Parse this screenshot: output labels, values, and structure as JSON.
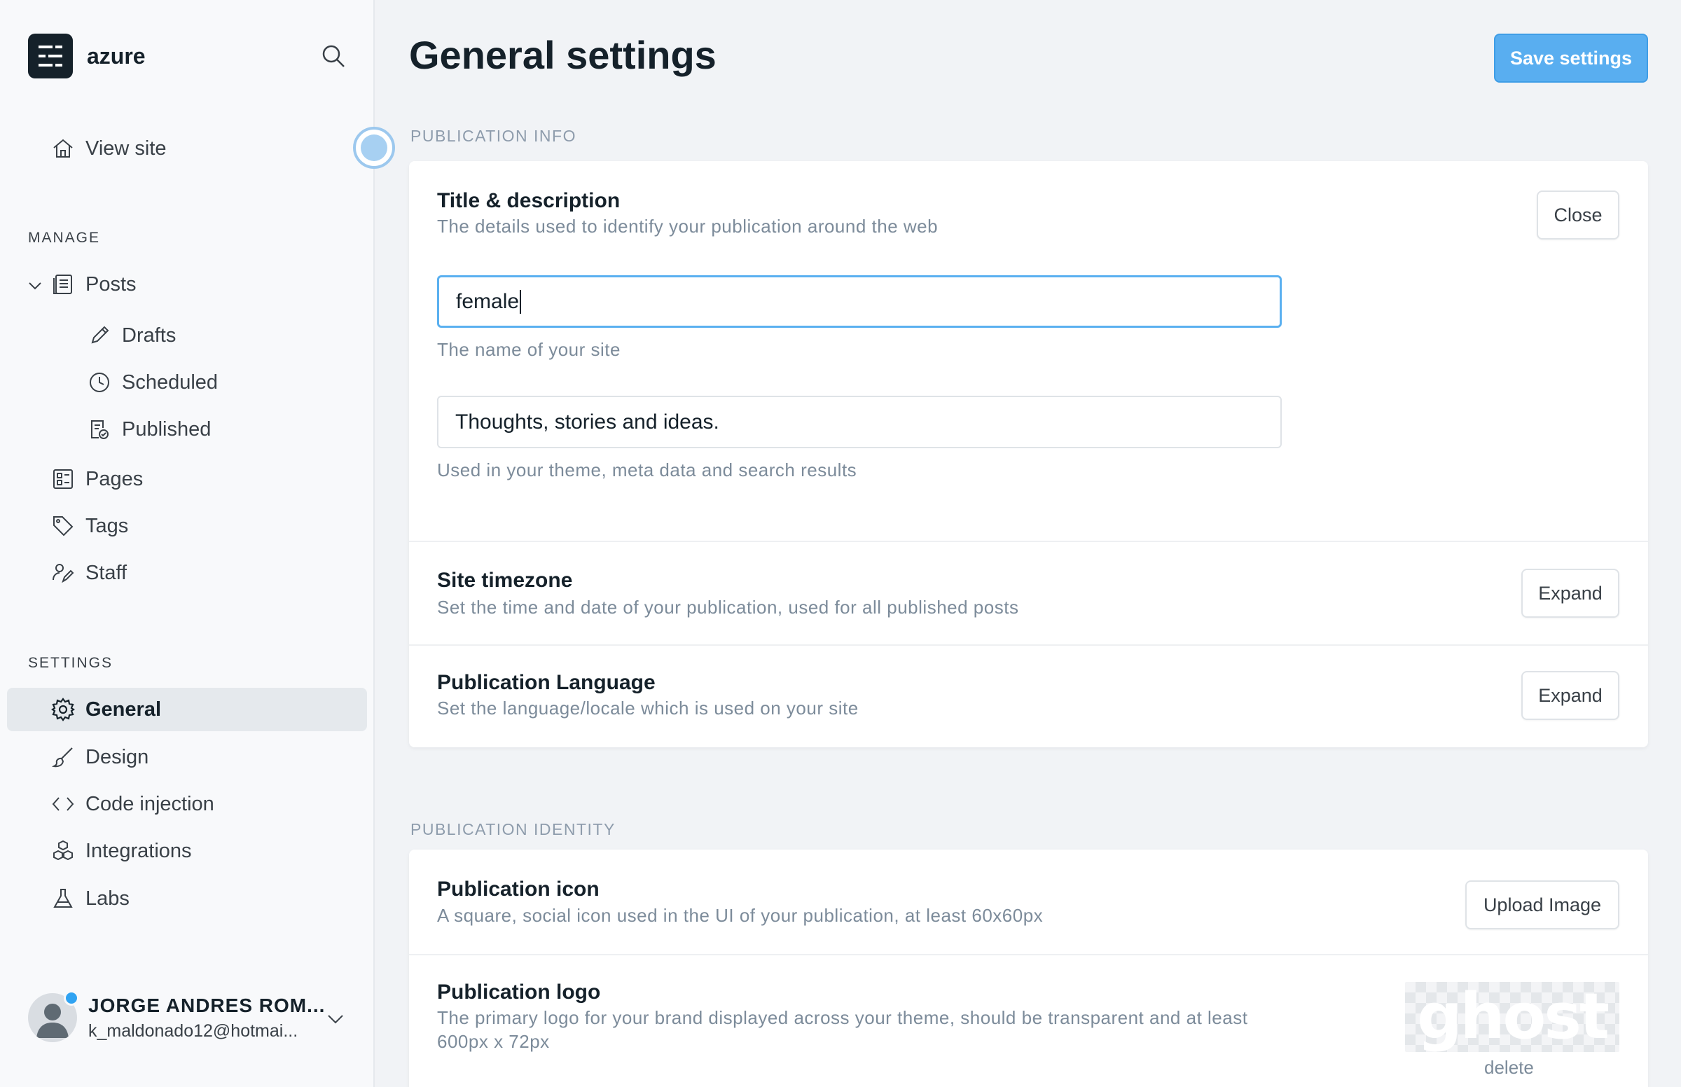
{
  "sidebar": {
    "brand": "azure",
    "view_site": "View site",
    "manage_label": "MANAGE",
    "manage_items": {
      "posts": "Posts",
      "drafts": "Drafts",
      "scheduled": "Scheduled",
      "published": "Published",
      "pages": "Pages",
      "tags": "Tags",
      "staff": "Staff"
    },
    "settings_label": "SETTINGS",
    "settings_items": {
      "general": "General",
      "design": "Design",
      "code_injection": "Code injection",
      "integrations": "Integrations",
      "labs": "Labs"
    },
    "user": {
      "name": "JORGE ANDRES ROM...",
      "email": "k_maldonado12@hotmai..."
    }
  },
  "header": {
    "title": "General settings",
    "save_label": "Save settings"
  },
  "publication_info": {
    "label": "PUBLICATION INFO",
    "title_desc": {
      "title": "Title & description",
      "desc": "The details used to identify your publication around the web",
      "close_label": "Close",
      "site_title_value": "female",
      "site_title_hint": "The name of your site",
      "site_desc_value": "Thoughts, stories and ideas.",
      "site_desc_hint": "Used in your theme, meta data and search results"
    },
    "timezone": {
      "title": "Site timezone",
      "desc": "Set the time and date of your publication, used for all published posts",
      "expand_label": "Expand"
    },
    "language": {
      "title": "Publication Language",
      "desc": "Set the language/locale which is used on your site",
      "expand_label": "Expand"
    }
  },
  "publication_identity": {
    "label": "PUBLICATION IDENTITY",
    "icon": {
      "title": "Publication icon",
      "desc": "A square, social icon used in the UI of your publication, at least 60x60px",
      "upload_label": "Upload Image"
    },
    "logo": {
      "title": "Publication logo",
      "desc": "The primary logo for your brand displayed across your theme, should be transparent and at least 600px x 72px",
      "preview_text": "ghost",
      "delete_label": "delete"
    }
  },
  "colors": {
    "accent": "#59aef0",
    "text": "#15212a",
    "muted": "#7c8b9a",
    "sidebar_bg": "#f8f9fb",
    "main_bg": "#f1f3f6"
  }
}
